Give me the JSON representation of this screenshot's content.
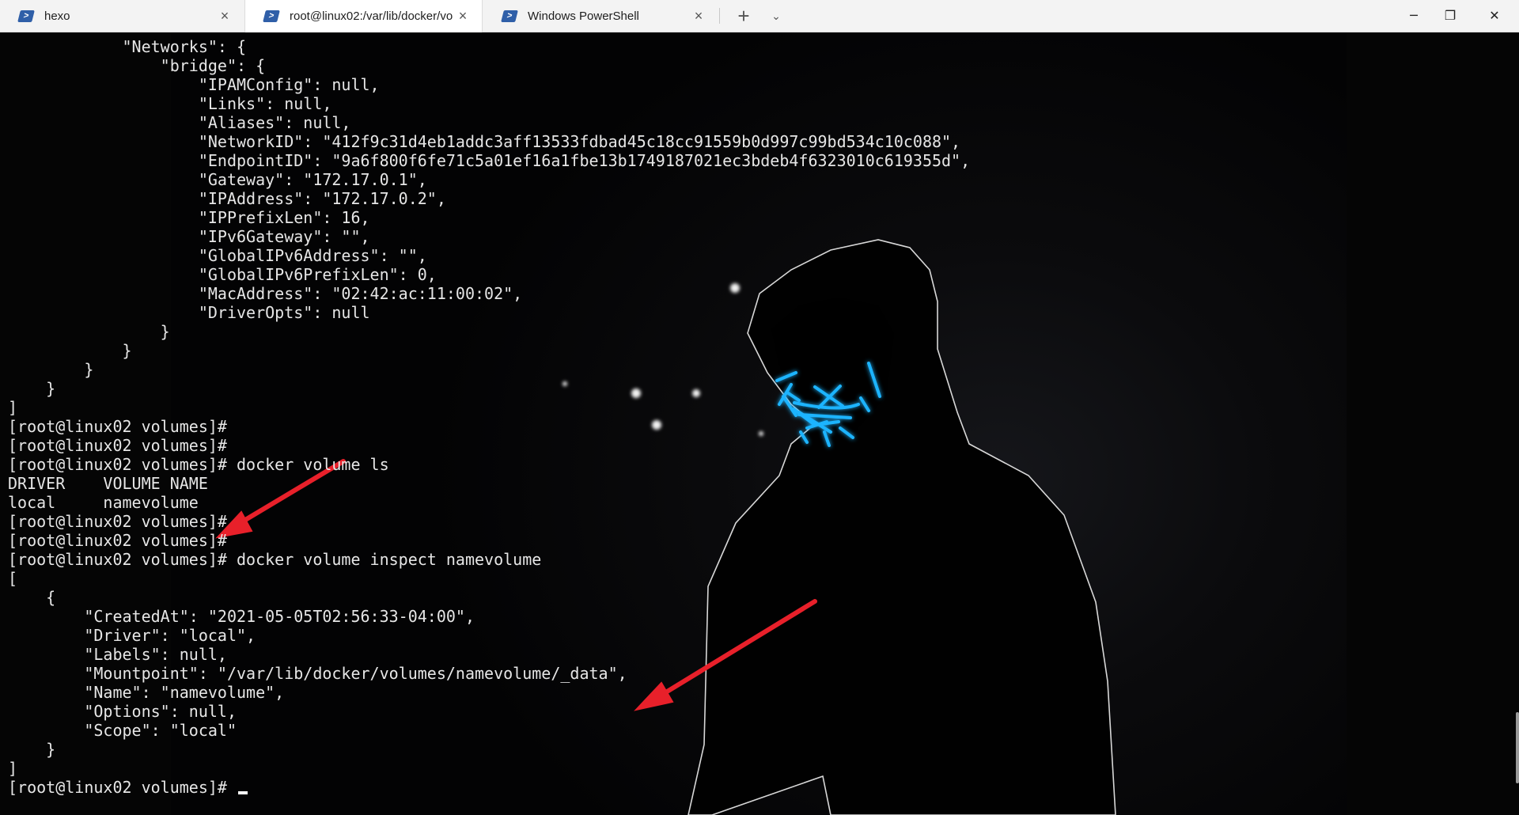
{
  "tabs": [
    {
      "title": "hexo",
      "icon": "powershell-icon",
      "active": false
    },
    {
      "title": "root@linux02:/var/lib/docker/vo",
      "icon": "powershell-icon",
      "active": true
    },
    {
      "title": "Windows PowerShell",
      "icon": "powershell-icon",
      "active": false
    }
  ],
  "tab_actions": {
    "new_tab": "+",
    "dropdown": "⌄"
  },
  "window_controls": {
    "minimize": "─",
    "maximize": "❐",
    "close": "✕"
  },
  "colors": {
    "arrow": "#e8202a",
    "mask_glow": "#1fb4ff",
    "terminal_text": "#e6e6e6",
    "tab_bar": "#f3f3f3"
  },
  "terminal": {
    "lines": [
      "            \"Networks\": {",
      "                \"bridge\": {",
      "                    \"IPAMConfig\": null,",
      "                    \"Links\": null,",
      "                    \"Aliases\": null,",
      "                    \"NetworkID\": \"412f9c31d4eb1addc3aff13533fdbad45c18cc91559b0d997c99bd534c10c088\",",
      "                    \"EndpointID\": \"9a6f800f6fe71c5a01ef16a1fbe13b1749187021ec3bdeb4f6323010c619355d\",",
      "                    \"Gateway\": \"172.17.0.1\",",
      "                    \"IPAddress\": \"172.17.0.2\",",
      "                    \"IPPrefixLen\": 16,",
      "                    \"IPv6Gateway\": \"\",",
      "                    \"GlobalIPv6Address\": \"\",",
      "                    \"GlobalIPv6PrefixLen\": 0,",
      "                    \"MacAddress\": \"02:42:ac:11:00:02\",",
      "                    \"DriverOpts\": null",
      "                }",
      "            }",
      "        }",
      "    }",
      "]",
      "[root@linux02 volumes]#",
      "[root@linux02 volumes]#",
      "[root@linux02 volumes]# docker volume ls",
      "DRIVER    VOLUME NAME",
      "local     namevolume",
      "[root@linux02 volumes]#",
      "[root@linux02 volumes]#",
      "[root@linux02 volumes]# docker volume inspect namevolume",
      "[",
      "    {",
      "        \"CreatedAt\": \"2021-05-05T02:56:33-04:00\",",
      "        \"Driver\": \"local\",",
      "        \"Labels\": null,",
      "        \"Mountpoint\": \"/var/lib/docker/volumes/namevolume/_data\",",
      "        \"Name\": \"namevolume\",",
      "        \"Options\": null,",
      "        \"Scope\": \"local\"",
      "    }",
      "]"
    ],
    "prompt": "[root@linux02 volumes]# "
  }
}
